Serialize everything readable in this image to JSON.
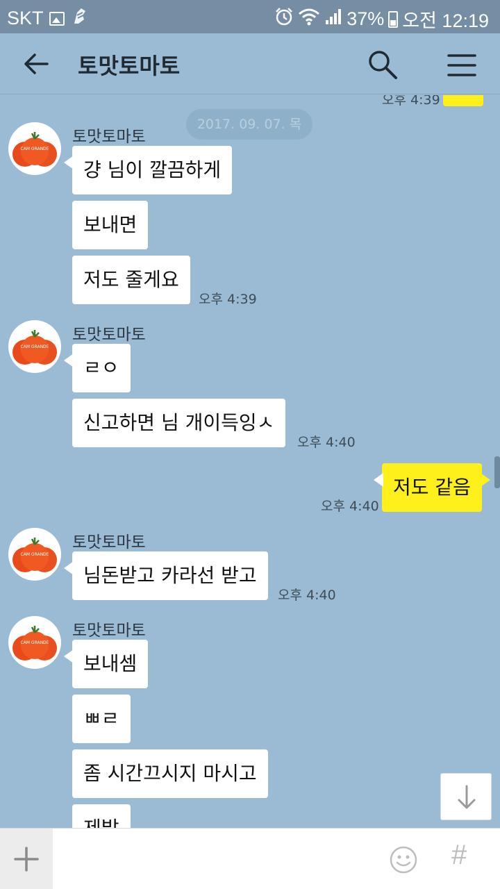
{
  "status_bar": {
    "carrier": "SKT",
    "battery": "37%",
    "time": "오전 12:19"
  },
  "header": {
    "title": "토맛토마토"
  },
  "chat": {
    "top_time": "오후 4:39",
    "date_divider": "2017. 09. 07. 목",
    "avatar_text": "CAM GRANDE",
    "groups": [
      {
        "sender": "토맛토마토",
        "messages": [
          "걍 님이 깔끔하게",
          "보내면",
          "저도 줄게요"
        ],
        "time": "오후 4:39"
      },
      {
        "sender": "토맛토마토",
        "messages": [
          "ㄹㅇ",
          "신고하면 님 개이득잉ㅅ"
        ],
        "time": "오후 4:40"
      },
      {
        "me": true,
        "messages": [
          "저도 같음"
        ],
        "time": "오후 4:40"
      },
      {
        "sender": "토맛토마토",
        "messages": [
          "님돈받고 카라선 받고"
        ],
        "time": "오후 4:40"
      },
      {
        "sender": "토맛토마토",
        "messages": [
          "보내셈",
          "ㅃㄹ",
          "좀 시간끄시지 마시고",
          "제발"
        ]
      }
    ]
  },
  "input": {
    "placeholder": "",
    "hash_label": "#"
  },
  "colors": {
    "background": "#9bbbd4",
    "my_bubble": "#fef01b",
    "their_bubble": "#ffffff",
    "status_bar": "#758ea3"
  }
}
